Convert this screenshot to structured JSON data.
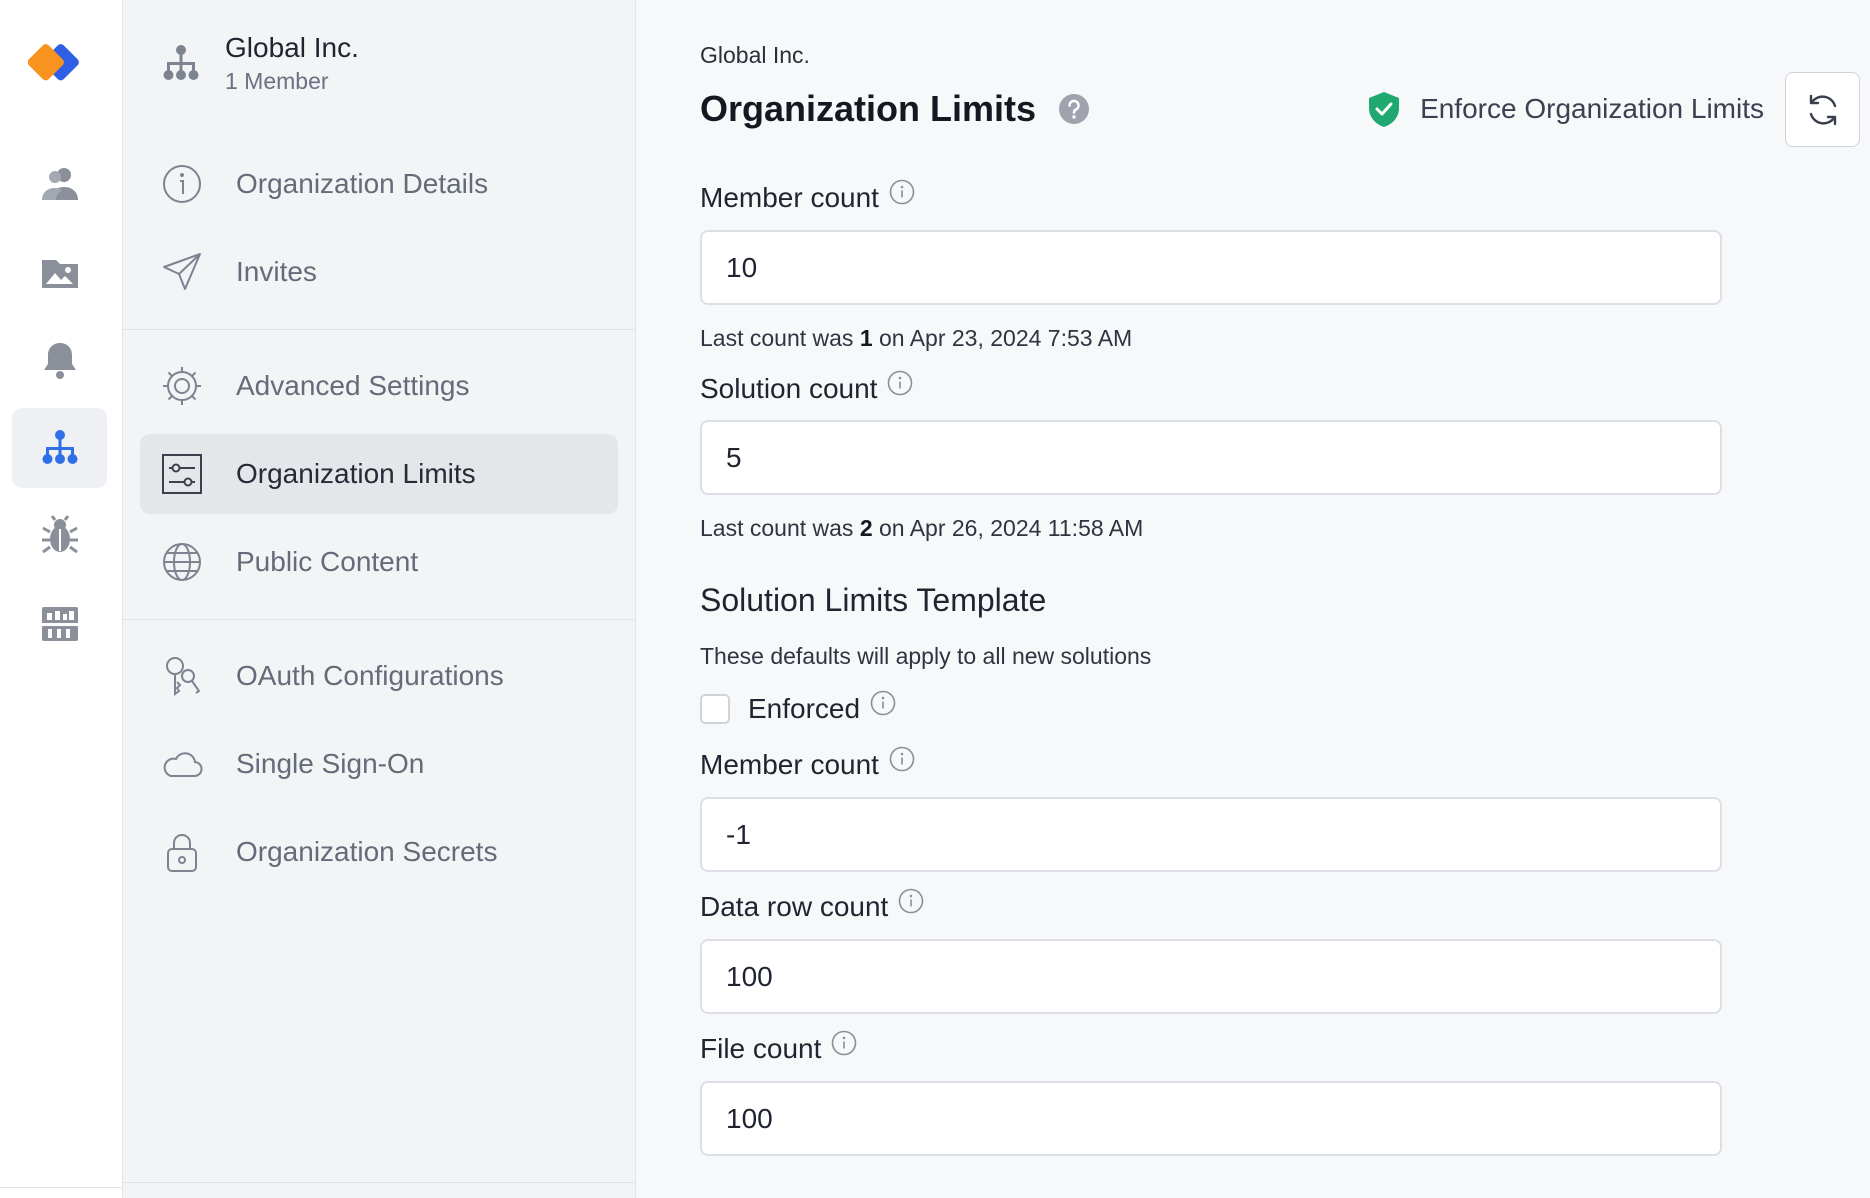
{
  "sidebar": {
    "org_name": "Global Inc.",
    "org_members": "1 Member",
    "items": [
      {
        "label": "Organization Details",
        "icon": "info-circle-icon"
      },
      {
        "label": "Invites",
        "icon": "paper-plane-icon"
      },
      {
        "label": "Advanced Settings",
        "icon": "gear-icon"
      },
      {
        "label": "Organization Limits",
        "icon": "sliders-icon",
        "active": true
      },
      {
        "label": "Public Content",
        "icon": "globe-icon"
      },
      {
        "label": "OAuth Configurations",
        "icon": "keys-icon"
      },
      {
        "label": "Single Sign-On",
        "icon": "cloud-icon"
      },
      {
        "label": "Organization Secrets",
        "icon": "lock-icon"
      }
    ]
  },
  "rail": {
    "items": [
      "users-icon",
      "image-folder-icon",
      "bell-icon",
      "org-tree-icon",
      "bug-icon",
      "chart-panel-icon"
    ],
    "active": "org-tree-icon",
    "accent_color": "#2f6fe8"
  },
  "main": {
    "breadcrumb": "Global Inc.",
    "title": "Organization Limits",
    "enforce_label": "Enforce Organization Limits",
    "enforce_color": "#1fa870",
    "member_count": {
      "label": "Member count",
      "value": "10"
    },
    "member_hint": {
      "pre": "Last count was ",
      "num": "1",
      "post": " on Apr 23, 2024 7:53 AM"
    },
    "solution_count": {
      "label": "Solution count",
      "value": "5"
    },
    "solution_hint": {
      "pre": "Last count was ",
      "num": "2",
      "post": " on Apr 26, 2024 11:58 AM"
    },
    "template": {
      "title": "Solution Limits Template",
      "description": "These defaults will apply to all new solutions",
      "enforced_label": "Enforced",
      "member_count": {
        "label": "Member count",
        "value": "-1"
      },
      "data_row_count": {
        "label": "Data row count",
        "value": "100"
      },
      "file_count": {
        "label": "File count",
        "value": "100"
      }
    }
  }
}
